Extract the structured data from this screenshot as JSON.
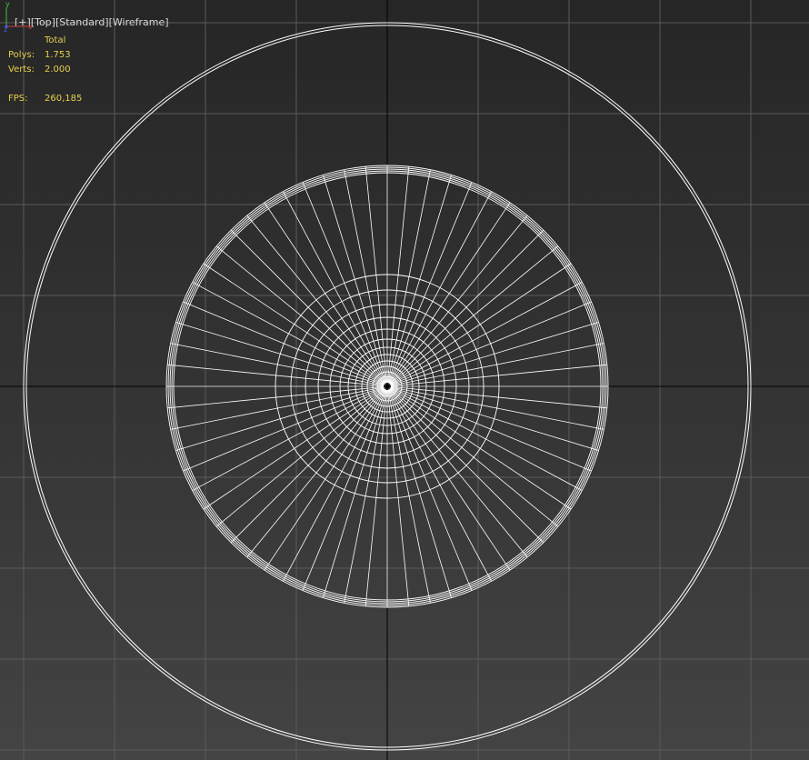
{
  "viewport": {
    "label_parts": [
      "[+]",
      "[Top]",
      "[Standard]",
      "[Wireframe]"
    ]
  },
  "stats": {
    "header": "Total",
    "polys_label": "Polys:",
    "polys_value": "1.753",
    "verts_label": "Verts:",
    "verts_value": "2.000",
    "fps_label": "FPS:",
    "fps_value": "260,185"
  },
  "axis_gizmo": {
    "y_label": "y",
    "z_label": "z",
    "x_label": "x"
  },
  "colors": {
    "grid": "#5a5a5a",
    "world_axis": "#000000",
    "wireframe": "#ffffff",
    "stats_text": "#e5d04c",
    "label_text": "#d8d8d8",
    "gizmo_x": "#d04040",
    "gizmo_y": "#40c040",
    "gizmo_z": "#4060e0"
  }
}
